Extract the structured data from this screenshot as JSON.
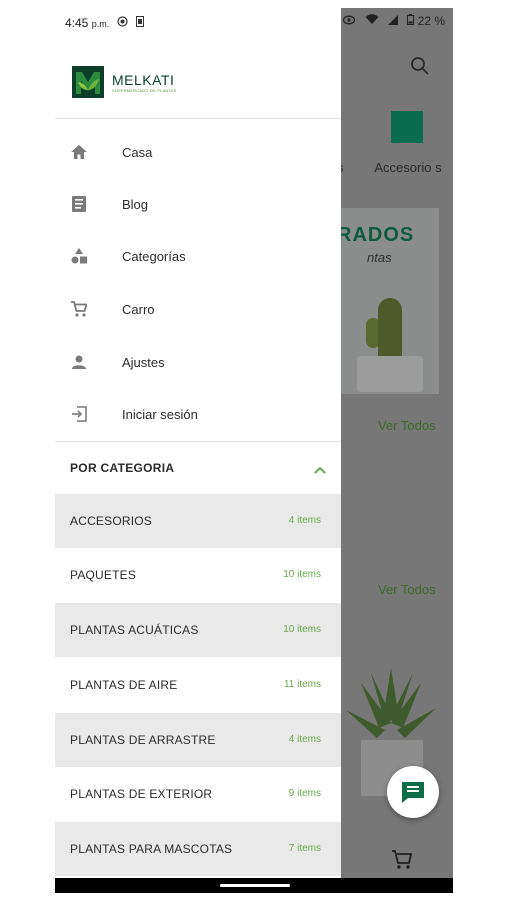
{
  "status_bar": {
    "time": "4:45",
    "ampm": "p.m.",
    "battery": "22 %"
  },
  "logo": {
    "name": "MELKATI",
    "tagline": "SUPERMERCADO DE PLANTAS"
  },
  "menu": [
    {
      "icon": "home-icon",
      "label": "Casa"
    },
    {
      "icon": "blog-icon",
      "label": "Blog"
    },
    {
      "icon": "categories-icon",
      "label": "Categorías"
    },
    {
      "icon": "cart-icon",
      "label": "Carro"
    },
    {
      "icon": "person-icon",
      "label": "Ajustes"
    },
    {
      "icon": "login-icon",
      "label": "Iniciar sesión"
    }
  ],
  "category_section": {
    "title": "POR CATEGORIA",
    "expanded": true
  },
  "categories": [
    {
      "name": "ACCESORIOS",
      "count": "4 items"
    },
    {
      "name": "PAQUETES",
      "count": "10 items"
    },
    {
      "name": "PLANTAS ACUÁTICAS",
      "count": "10 items"
    },
    {
      "name": "PLANTAS DE AIRE",
      "count": "11 items"
    },
    {
      "name": "PLANTAS DE ARRASTRE",
      "count": "4 items"
    },
    {
      "name": "PLANTAS DE EXTERIOR",
      "count": "9 items"
    },
    {
      "name": "PLANTAS PARA MASCOTAS",
      "count": "7 items"
    }
  ],
  "background": {
    "category_suffix": "s",
    "accesorios_label": "Accesorio s",
    "banner_text": "RADOS",
    "banner_script": "ntas",
    "ver_todos_1": "Ver Todos",
    "ver_todos_2": "Ver Todos"
  },
  "colors": {
    "accent_green": "#6aa84f",
    "brand_dark": "#0c3f2a",
    "shaded_row": "#e9e9e9"
  }
}
